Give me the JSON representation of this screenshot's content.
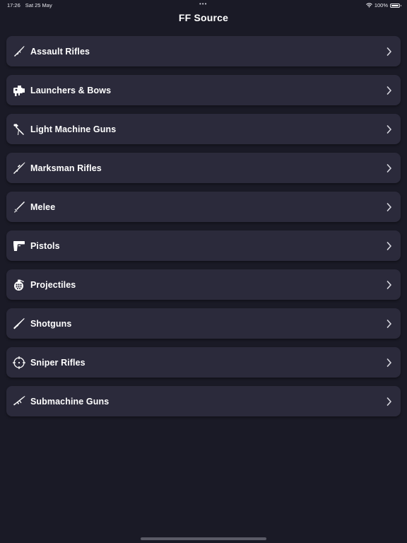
{
  "status_bar": {
    "time": "17:26",
    "date": "Sat 25 May",
    "battery": "100%",
    "battery_level": 1.0,
    "dots": "•••"
  },
  "nav": {
    "title": "FF Source"
  },
  "categories": [
    {
      "label": "Assault Rifles",
      "icon": "assault-rifle-icon"
    },
    {
      "label": "Launchers & Bows",
      "icon": "launcher-icon"
    },
    {
      "label": "Light Machine Guns",
      "icon": "machine-gun-icon"
    },
    {
      "label": "Marksman Rifles",
      "icon": "marksman-rifle-icon"
    },
    {
      "label": "Melee",
      "icon": "sword-icon"
    },
    {
      "label": "Pistols",
      "icon": "pistol-icon"
    },
    {
      "label": "Projectiles",
      "icon": "grenade-icon"
    },
    {
      "label": "Shotguns",
      "icon": "shotgun-icon"
    },
    {
      "label": "Sniper Rifles",
      "icon": "crosshair-icon"
    },
    {
      "label": "Submachine Guns",
      "icon": "submachine-gun-icon"
    }
  ],
  "colors": {
    "background": "#1a1a26",
    "row_background": "#2b2a3b",
    "text": "#ffffff",
    "chevron": "#d8d8e0"
  }
}
